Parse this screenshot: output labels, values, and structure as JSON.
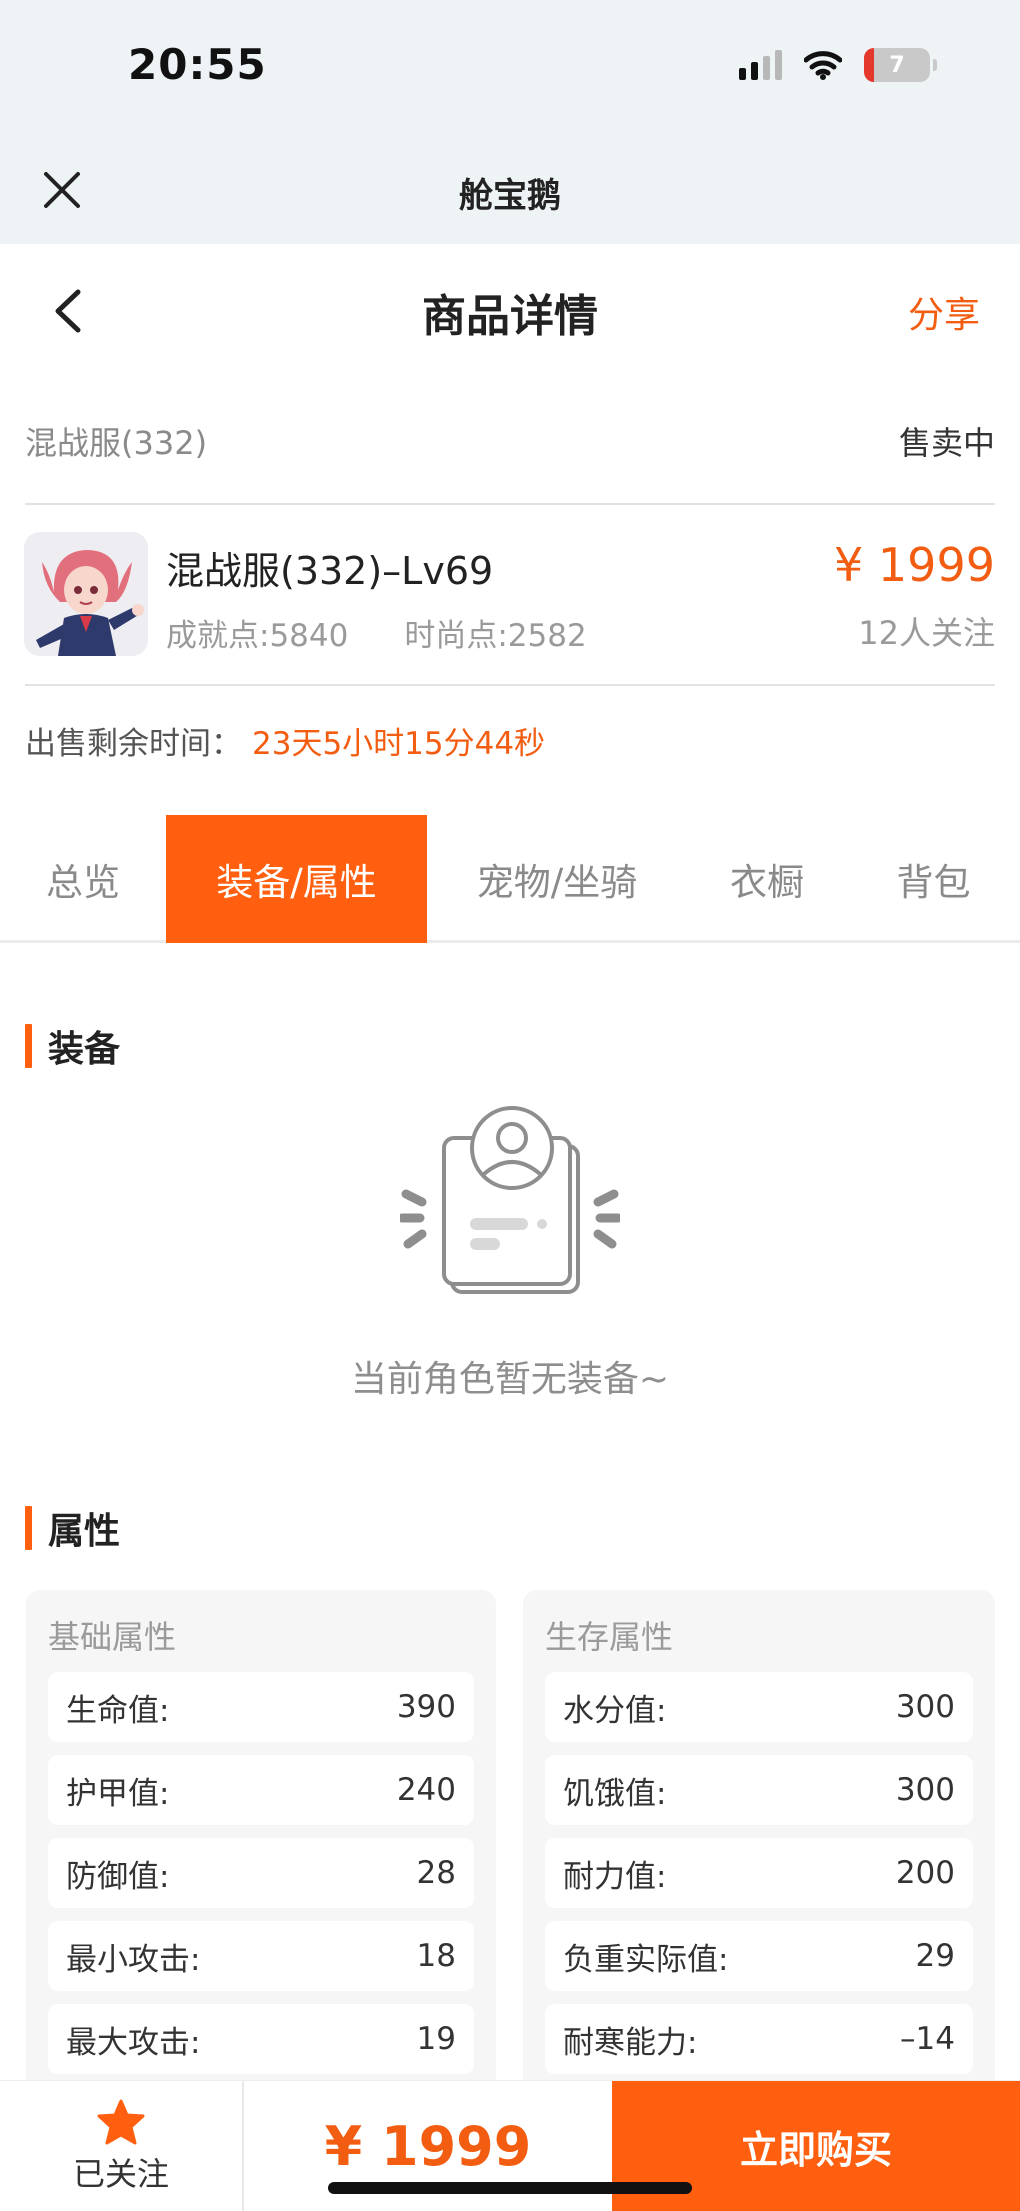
{
  "status_bar": {
    "time": "20:55",
    "battery": "7"
  },
  "miniapp": {
    "title": "舱宝鹅"
  },
  "header": {
    "title": "商品详情",
    "share": "分享"
  },
  "server": {
    "name": "混战服(332)",
    "status": "售卖中"
  },
  "product": {
    "name": "混战服(332)–Lv69",
    "achievement": "成就点:5840",
    "fashion": "时尚点:2582",
    "price": "¥ 1999",
    "watchers": "12人关注"
  },
  "sale_time": {
    "label": "出售剩余时间：",
    "value": "23天5小时15分44秒"
  },
  "tabs": [
    {
      "label": "总览",
      "active": false
    },
    {
      "label": "装备/属性",
      "active": true
    },
    {
      "label": "宠物/坐骑",
      "active": false
    },
    {
      "label": "衣橱",
      "active": false
    },
    {
      "label": "背包",
      "active": false
    }
  ],
  "equipment": {
    "title": "装备",
    "empty_text": "当前角色暂无装备~"
  },
  "attributes": {
    "title": "属性",
    "basic": {
      "title": "基础属性",
      "rows": [
        {
          "label": "生命值:",
          "value": "390"
        },
        {
          "label": "护甲值:",
          "value": "240"
        },
        {
          "label": "防御值:",
          "value": "28"
        },
        {
          "label": "最小攻击:",
          "value": "18"
        },
        {
          "label": "最大攻击:",
          "value": "19"
        }
      ]
    },
    "survival": {
      "title": "生存属性",
      "rows": [
        {
          "label": "水分值:",
          "value": "300"
        },
        {
          "label": "饥饿值:",
          "value": "300"
        },
        {
          "label": "耐力值:",
          "value": "200"
        },
        {
          "label": "负重实际值:",
          "value": "29"
        },
        {
          "label": "耐寒能力:",
          "value": "–14"
        }
      ]
    }
  },
  "bottom": {
    "follow_label": "已关注",
    "price": "¥ 1999",
    "buy": "立即购买"
  },
  "colors": {
    "accent": "#ff5f0f",
    "price": "#f25d12",
    "header_bg": "#eef3f6"
  },
  "icons": [
    "close-icon",
    "back-icon",
    "empty-profile-icon",
    "star-icon",
    "wifi-icon",
    "signal-icon",
    "battery-icon"
  ]
}
